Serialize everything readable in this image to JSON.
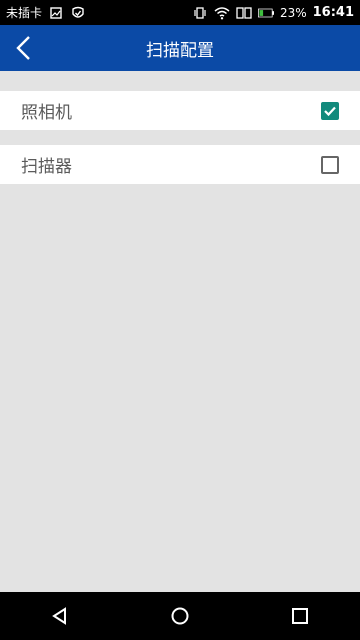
{
  "status_bar": {
    "carrier": "未插卡",
    "battery_percent": "23%",
    "time": "16:41",
    "icons": [
      "image-icon",
      "shield-icon",
      "vibrate-icon",
      "wifi-icon",
      "sim-icon",
      "battery-icon"
    ]
  },
  "header": {
    "title": "扫描配置",
    "back_icon": "chevron-left-icon"
  },
  "options": [
    {
      "label": "照相机",
      "checked": true
    },
    {
      "label": "扫描器",
      "checked": false
    }
  ],
  "nav": {
    "icons": [
      "back-triangle-icon",
      "home-circle-icon",
      "recents-square-icon"
    ]
  },
  "colors": {
    "header_bg": "#0b4aa6",
    "checkbox_checked": "#128a7c",
    "page_bg": "#e3e3e3"
  }
}
